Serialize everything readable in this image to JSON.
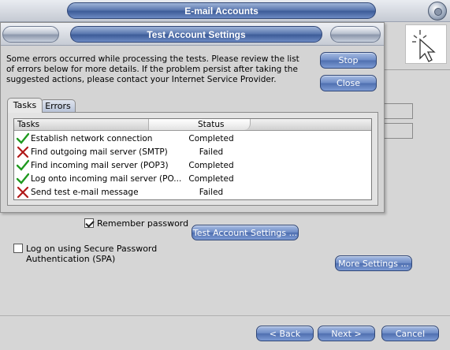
{
  "window": {
    "title": "E-mail Accounts"
  },
  "dialog": {
    "title": "Test Account Settings",
    "message": "Some errors occurred while processing the tests. Please review the list of errors below for more details. If the problem persist after taking the suggested actions, please contact your Internet Service Provider.",
    "stop_label": "Stop",
    "close_label": "Close",
    "tabs": [
      {
        "label": "Tasks",
        "active": true
      },
      {
        "label": "Errors",
        "active": false
      }
    ],
    "columns": {
      "tasks": "Tasks",
      "status": "Status"
    },
    "tasks": [
      {
        "name": "Establish network connection",
        "status": "Completed",
        "icon": "check-icon"
      },
      {
        "name": "Find outgoing mail server (SMTP)",
        "status": "Failed",
        "icon": "x-icon"
      },
      {
        "name": "Find incoming mail server (POP3)",
        "status": "Completed",
        "icon": "check-icon"
      },
      {
        "name": "Log onto incoming mail server (PO...",
        "status": "Completed",
        "icon": "check-icon"
      },
      {
        "name": "Send test e-mail message",
        "status": "Failed",
        "icon": "x-icon"
      }
    ]
  },
  "wizard": {
    "remember_password_label": "Remember password",
    "remember_password_checked": true,
    "spa_label": "Log on using Secure Password Authentication (SPA)",
    "spa_checked": false,
    "test_button_label": "Test Account Settings ...",
    "more_settings_label": "More Settings ...",
    "back_label": "< Back",
    "next_label": "Next >",
    "cancel_label": "Cancel"
  },
  "colors": {
    "check": "#1f9a1f",
    "fail": "#b01818",
    "button_blue": "#4f6fb0"
  }
}
